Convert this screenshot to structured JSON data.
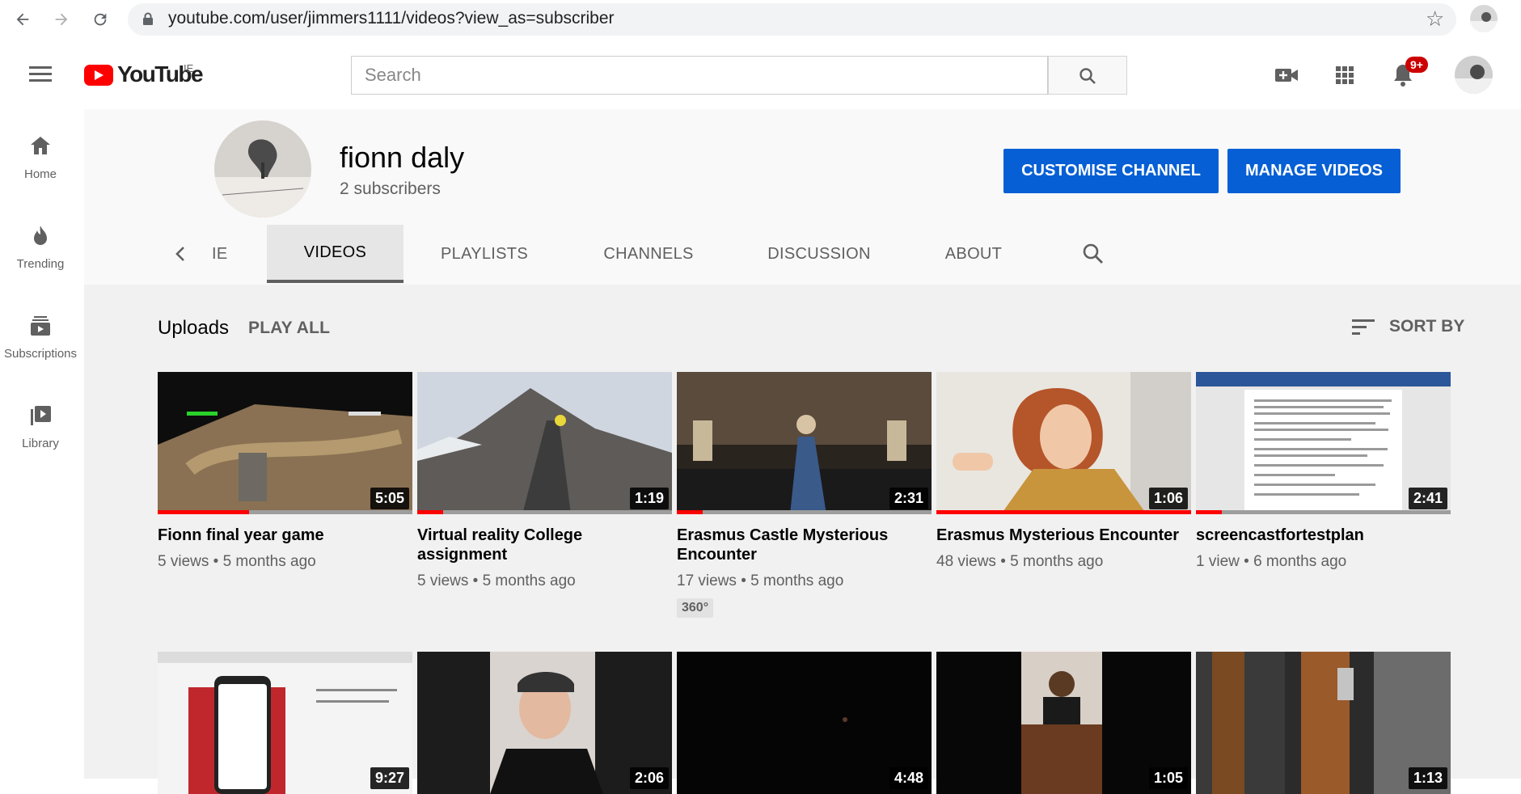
{
  "browser": {
    "url": "youtube.com/user/jimmers1111/videos?view_as=subscriber",
    "back_icon": "arrow-left-icon",
    "forward_icon": "arrow-right-icon",
    "reload_icon": "reload-icon"
  },
  "masthead": {
    "logo_text": "YouTube",
    "country_code": "IE",
    "search_placeholder": "Search",
    "notification_count": "9+"
  },
  "sidebar": {
    "items": [
      {
        "label": "Home",
        "icon": "home-icon"
      },
      {
        "label": "Trending",
        "icon": "flame-icon"
      },
      {
        "label": "Subscriptions",
        "icon": "subscriptions-icon"
      },
      {
        "label": "Library",
        "icon": "library-icon"
      }
    ]
  },
  "channel": {
    "name": "fionn daly",
    "subscribers": "2 subscribers",
    "customise_label": "CUSTOMISE CHANNEL",
    "manage_label": "MANAGE VIDEOS"
  },
  "tabs": {
    "partial": "IE",
    "items": [
      "VIDEOS",
      "PLAYLISTS",
      "CHANNELS",
      "DISCUSSION",
      "ABOUT"
    ],
    "selected": "VIDEOS"
  },
  "uploads": {
    "title": "Uploads",
    "play_all": "PLAY ALL",
    "sort_by": "SORT BY"
  },
  "videos": [
    {
      "title": "Fionn final year game",
      "views": "5 views",
      "age": "5 months ago",
      "duration": "5:05",
      "watched": 0.36
    },
    {
      "title": "Virtual reality College assignment",
      "views": "5 views",
      "age": "5 months ago",
      "duration": "1:19",
      "watched": 0.1
    },
    {
      "title": "Erasmus Castle Mysterious Encounter",
      "views": "17 views",
      "age": "5 months ago",
      "duration": "2:31",
      "watched": 0.1,
      "badge": "360°"
    },
    {
      "title": "Erasmus Mysterious Encounter",
      "views": "48 views",
      "age": "5 months ago",
      "duration": "1:06",
      "watched": 1.0
    },
    {
      "title": "screencastfortestplan",
      "views": "1 view",
      "age": "6 months ago",
      "duration": "2:41",
      "watched": 0.1
    }
  ],
  "videos_row2": [
    {
      "duration": "9:27"
    },
    {
      "duration": "2:06"
    },
    {
      "duration": "4:48"
    },
    {
      "duration": "1:05"
    },
    {
      "duration": "1:13"
    }
  ],
  "colors": {
    "accent_blue": "#065fd4",
    "youtube_red": "#ff0000",
    "content_bg": "#f1f1f1"
  }
}
